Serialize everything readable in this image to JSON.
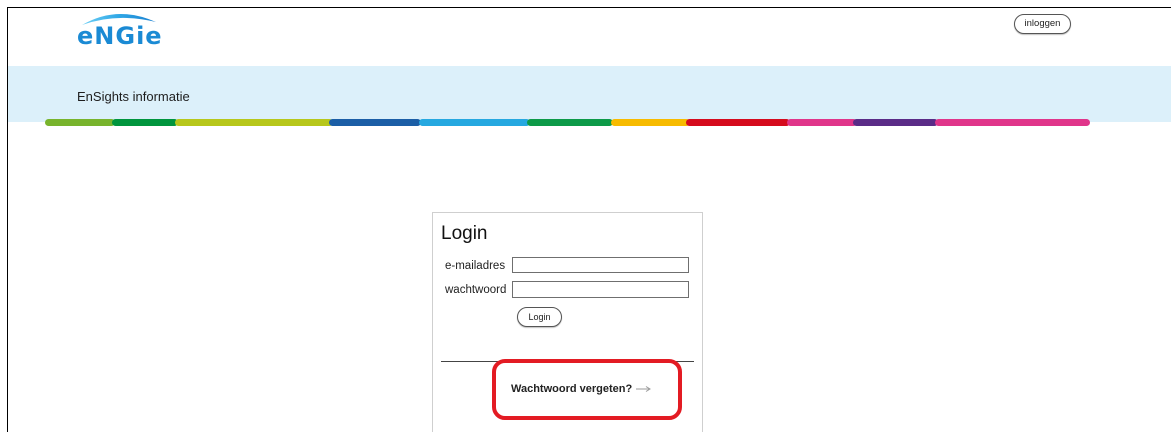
{
  "header": {
    "logo_text": "eNGie",
    "login_button_label": "inloggen"
  },
  "banner": {
    "title": "EnSights informatie",
    "background_color": "#dcf0fa"
  },
  "brand_stripe": [
    "#78b42c",
    "#00953d",
    "#b7c71b",
    "#1b5ea6",
    "#26a8e0",
    "#0d9a48",
    "#f7bb00",
    "#d50b1d",
    "#e0358a",
    "#5a2b87",
    "#e0358a"
  ],
  "login_panel": {
    "title": "Login",
    "email_label": "e-mailadres",
    "email_value": "",
    "password_label": "wachtwoord",
    "password_value": "",
    "submit_label": "Login",
    "forgot_password_label": "Wachtwoord vergeten?",
    "forgot_password_icon": "arrow-right-icon"
  },
  "colors": {
    "logo_blue": "#1a8ad4",
    "highlight_red": "#e31b23"
  }
}
